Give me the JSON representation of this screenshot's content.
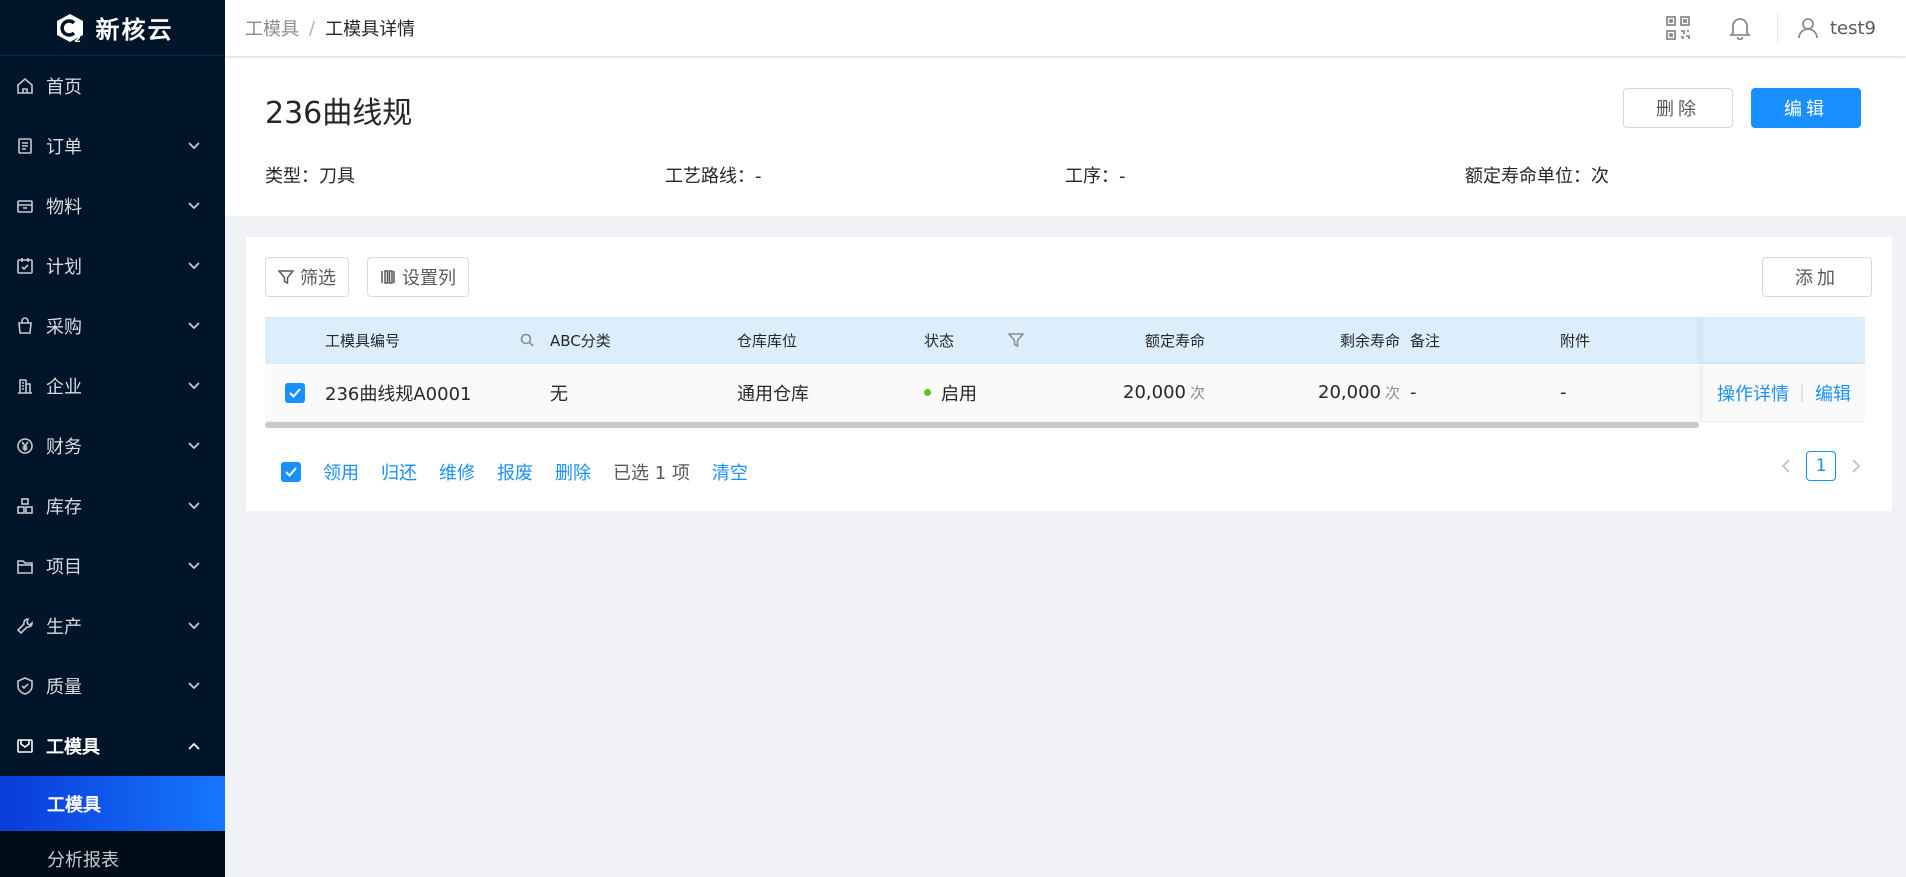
{
  "app": {
    "name": "新核云"
  },
  "sidebar": {
    "items": [
      {
        "label": "首页",
        "icon": "home-icon",
        "has_arrow": false
      },
      {
        "label": "订单",
        "icon": "order-icon",
        "has_arrow": true
      },
      {
        "label": "物料",
        "icon": "material-icon",
        "has_arrow": true
      },
      {
        "label": "计划",
        "icon": "plan-icon",
        "has_arrow": true
      },
      {
        "label": "采购",
        "icon": "purchase-icon",
        "has_arrow": true
      },
      {
        "label": "企业",
        "icon": "enterprise-icon",
        "has_arrow": true
      },
      {
        "label": "财务",
        "icon": "finance-icon",
        "has_arrow": true
      },
      {
        "label": "库存",
        "icon": "inventory-icon",
        "has_arrow": true
      },
      {
        "label": "项目",
        "icon": "project-icon",
        "has_arrow": true
      },
      {
        "label": "生产",
        "icon": "production-icon",
        "has_arrow": true
      },
      {
        "label": "质量",
        "icon": "quality-icon",
        "has_arrow": true
      },
      {
        "label": "工模具",
        "icon": "tooling-icon",
        "has_arrow": true,
        "open": true
      }
    ],
    "submenu": [
      {
        "label": "工模具",
        "active": true
      },
      {
        "label": "分析报表",
        "active": false
      }
    ]
  },
  "header": {
    "breadcrumb": [
      "工模具",
      "工模具详情"
    ],
    "user": "test9"
  },
  "detail": {
    "title": "236曲线规",
    "delete_label": "删除",
    "edit_label": "编辑",
    "info": [
      {
        "label": "类型：",
        "value": "刀具"
      },
      {
        "label": "工艺路线：",
        "value": "-"
      },
      {
        "label": "工序：",
        "value": "-"
      },
      {
        "label": "额定寿命单位：",
        "value": "次"
      }
    ]
  },
  "toolbar": {
    "filter_label": "筛选",
    "columns_label": "设置列",
    "add_label": "添加"
  },
  "table": {
    "headers": {
      "code": "工模具编号",
      "abc": "ABC分类",
      "warehouse": "仓库库位",
      "status": "状态",
      "rated_life": "额定寿命",
      "remaining_life": "剩余寿命",
      "note": "备注",
      "attachment": "附件"
    },
    "rows": [
      {
        "code": "236曲线规A0001",
        "abc": "无",
        "warehouse": "通用仓库",
        "status": "启用",
        "rated_life": "20,000",
        "rated_unit": "次",
        "remaining_life": "20,000",
        "remaining_unit": "次",
        "note": "-",
        "attachment": "-",
        "op_detail": "操作详情",
        "op_edit": "编辑"
      }
    ]
  },
  "batch": {
    "actions": [
      "领用",
      "归还",
      "维修",
      "报废",
      "删除"
    ],
    "selected_text": "已选 1 项",
    "clear_label": "清空"
  },
  "pagination": {
    "current": "1"
  },
  "colors": {
    "primary": "#1890ff",
    "sidebar_bg": "#001529",
    "status_green": "#52c41a"
  }
}
